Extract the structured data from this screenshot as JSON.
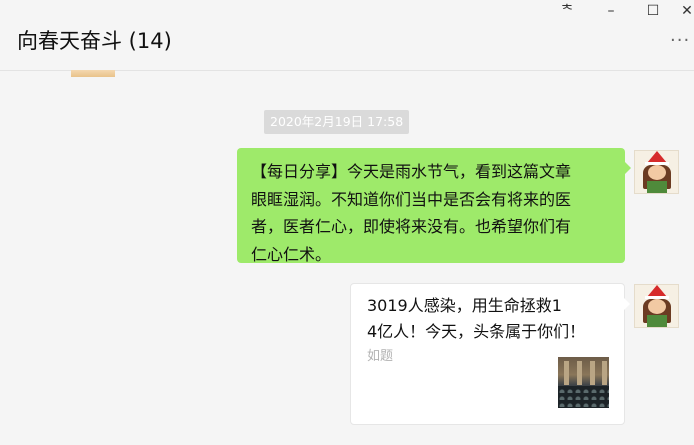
{
  "window": {
    "controls": {
      "pin": "ᅕ",
      "minimize": "–",
      "maximize": "☐",
      "close": "✕"
    }
  },
  "header": {
    "title": "向春天奋斗 (14)",
    "more_label": "···"
  },
  "messages": {
    "timestamp": "2020年2月19日 17:58",
    "text_lines": [
      "【每日分享】今天是雨水节气，看到这篇文章",
      "眼眶湿润。不知道你们当中是否会有将来的医",
      "者，医者仁心，即使将来没有。也希望你们有",
      "仁心仁术。"
    ],
    "card": {
      "title_lines": [
        "3019人感染，用生命拯救1",
        "4亿人！今天，头条属于你们！"
      ],
      "source": "如题"
    }
  },
  "colors": {
    "bubble_green": "#9eea6a",
    "background": "#f5f5f5",
    "timestamp_bg": "#dadada"
  },
  "icons": [
    "pin-icon",
    "minimize-icon",
    "maximize-icon",
    "close-icon",
    "more-icon",
    "avatar"
  ]
}
